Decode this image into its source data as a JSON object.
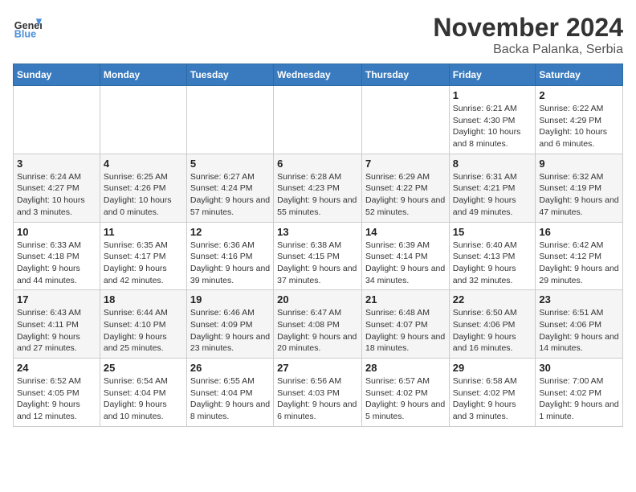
{
  "logo": {
    "text_general": "General",
    "text_blue": "Blue"
  },
  "title": {
    "month_year": "November 2024",
    "location": "Backa Palanka, Serbia"
  },
  "headers": [
    "Sunday",
    "Monday",
    "Tuesday",
    "Wednesday",
    "Thursday",
    "Friday",
    "Saturday"
  ],
  "weeks": [
    [
      {
        "day": "",
        "info": ""
      },
      {
        "day": "",
        "info": ""
      },
      {
        "day": "",
        "info": ""
      },
      {
        "day": "",
        "info": ""
      },
      {
        "day": "",
        "info": ""
      },
      {
        "day": "1",
        "info": "Sunrise: 6:21 AM\nSunset: 4:30 PM\nDaylight: 10 hours and 8 minutes."
      },
      {
        "day": "2",
        "info": "Sunrise: 6:22 AM\nSunset: 4:29 PM\nDaylight: 10 hours and 6 minutes."
      }
    ],
    [
      {
        "day": "3",
        "info": "Sunrise: 6:24 AM\nSunset: 4:27 PM\nDaylight: 10 hours and 3 minutes."
      },
      {
        "day": "4",
        "info": "Sunrise: 6:25 AM\nSunset: 4:26 PM\nDaylight: 10 hours and 0 minutes."
      },
      {
        "day": "5",
        "info": "Sunrise: 6:27 AM\nSunset: 4:24 PM\nDaylight: 9 hours and 57 minutes."
      },
      {
        "day": "6",
        "info": "Sunrise: 6:28 AM\nSunset: 4:23 PM\nDaylight: 9 hours and 55 minutes."
      },
      {
        "day": "7",
        "info": "Sunrise: 6:29 AM\nSunset: 4:22 PM\nDaylight: 9 hours and 52 minutes."
      },
      {
        "day": "8",
        "info": "Sunrise: 6:31 AM\nSunset: 4:21 PM\nDaylight: 9 hours and 49 minutes."
      },
      {
        "day": "9",
        "info": "Sunrise: 6:32 AM\nSunset: 4:19 PM\nDaylight: 9 hours and 47 minutes."
      }
    ],
    [
      {
        "day": "10",
        "info": "Sunrise: 6:33 AM\nSunset: 4:18 PM\nDaylight: 9 hours and 44 minutes."
      },
      {
        "day": "11",
        "info": "Sunrise: 6:35 AM\nSunset: 4:17 PM\nDaylight: 9 hours and 42 minutes."
      },
      {
        "day": "12",
        "info": "Sunrise: 6:36 AM\nSunset: 4:16 PM\nDaylight: 9 hours and 39 minutes."
      },
      {
        "day": "13",
        "info": "Sunrise: 6:38 AM\nSunset: 4:15 PM\nDaylight: 9 hours and 37 minutes."
      },
      {
        "day": "14",
        "info": "Sunrise: 6:39 AM\nSunset: 4:14 PM\nDaylight: 9 hours and 34 minutes."
      },
      {
        "day": "15",
        "info": "Sunrise: 6:40 AM\nSunset: 4:13 PM\nDaylight: 9 hours and 32 minutes."
      },
      {
        "day": "16",
        "info": "Sunrise: 6:42 AM\nSunset: 4:12 PM\nDaylight: 9 hours and 29 minutes."
      }
    ],
    [
      {
        "day": "17",
        "info": "Sunrise: 6:43 AM\nSunset: 4:11 PM\nDaylight: 9 hours and 27 minutes."
      },
      {
        "day": "18",
        "info": "Sunrise: 6:44 AM\nSunset: 4:10 PM\nDaylight: 9 hours and 25 minutes."
      },
      {
        "day": "19",
        "info": "Sunrise: 6:46 AM\nSunset: 4:09 PM\nDaylight: 9 hours and 23 minutes."
      },
      {
        "day": "20",
        "info": "Sunrise: 6:47 AM\nSunset: 4:08 PM\nDaylight: 9 hours and 20 minutes."
      },
      {
        "day": "21",
        "info": "Sunrise: 6:48 AM\nSunset: 4:07 PM\nDaylight: 9 hours and 18 minutes."
      },
      {
        "day": "22",
        "info": "Sunrise: 6:50 AM\nSunset: 4:06 PM\nDaylight: 9 hours and 16 minutes."
      },
      {
        "day": "23",
        "info": "Sunrise: 6:51 AM\nSunset: 4:06 PM\nDaylight: 9 hours and 14 minutes."
      }
    ],
    [
      {
        "day": "24",
        "info": "Sunrise: 6:52 AM\nSunset: 4:05 PM\nDaylight: 9 hours and 12 minutes."
      },
      {
        "day": "25",
        "info": "Sunrise: 6:54 AM\nSunset: 4:04 PM\nDaylight: 9 hours and 10 minutes."
      },
      {
        "day": "26",
        "info": "Sunrise: 6:55 AM\nSunset: 4:04 PM\nDaylight: 9 hours and 8 minutes."
      },
      {
        "day": "27",
        "info": "Sunrise: 6:56 AM\nSunset: 4:03 PM\nDaylight: 9 hours and 6 minutes."
      },
      {
        "day": "28",
        "info": "Sunrise: 6:57 AM\nSunset: 4:02 PM\nDaylight: 9 hours and 5 minutes."
      },
      {
        "day": "29",
        "info": "Sunrise: 6:58 AM\nSunset: 4:02 PM\nDaylight: 9 hours and 3 minutes."
      },
      {
        "day": "30",
        "info": "Sunrise: 7:00 AM\nSunset: 4:02 PM\nDaylight: 9 hours and 1 minute."
      }
    ]
  ]
}
